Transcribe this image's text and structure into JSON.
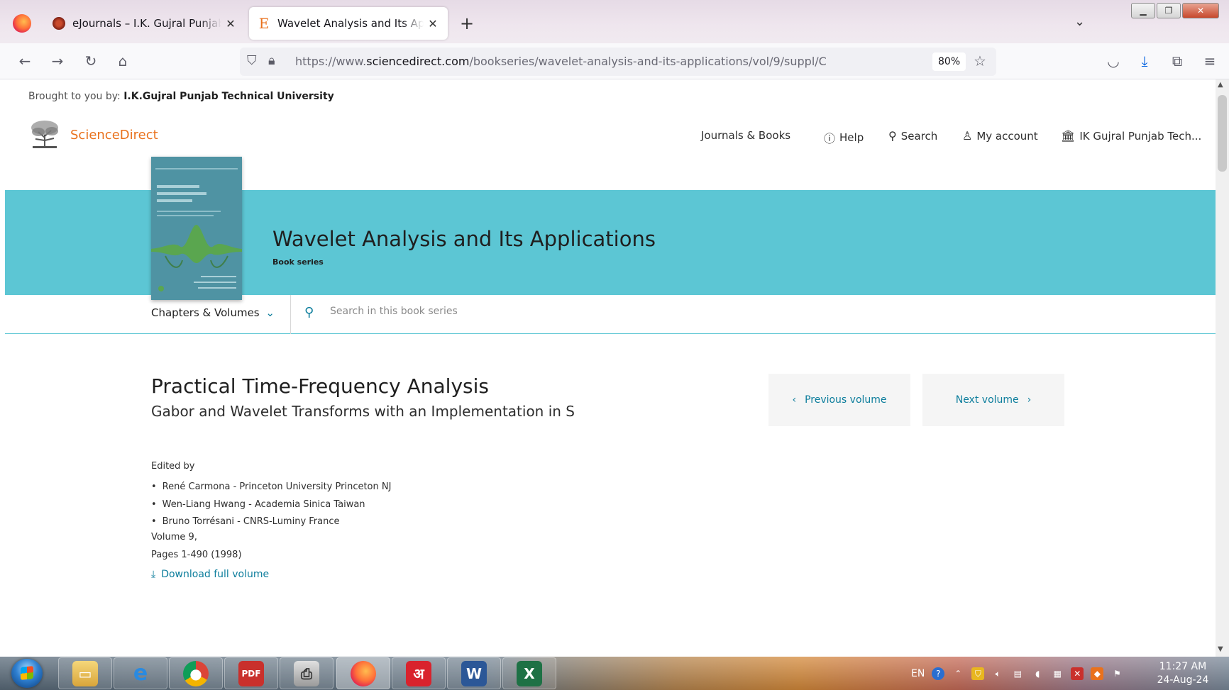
{
  "browser": {
    "tabs": [
      {
        "title": "eJournals – I.K. Gujral Punjab Technical University",
        "active": false
      },
      {
        "title": "Wavelet Analysis and Its Applications | Book series",
        "active": true
      }
    ],
    "url_prefix": "https://www.",
    "url_domain": "sciencedirect.com",
    "url_path": "/bookseries/wavelet-analysis-and-its-applications/vol/9/suppl/C",
    "zoom": "80%"
  },
  "site": {
    "brought_label": "Brought to you by:",
    "brought_org": "I.K.Gujral Punjab Technical University",
    "logo_text": "ScienceDirect",
    "nav": {
      "journals": "Journals & Books",
      "help": "Help",
      "search": "Search",
      "account": "My account",
      "institution": "IK Gujral Punjab Tech..."
    }
  },
  "series": {
    "title": "Wavelet Analysis and Its Applications",
    "subtitle": "Book series",
    "chapters_label": "Chapters & Volumes",
    "search_placeholder": "Search in this book series"
  },
  "volume": {
    "title": "Practical Time-Frequency Analysis",
    "subtitle": "Gabor and Wavelet Transforms with an Implementation in S",
    "prev_label": "Previous volume",
    "next_label": "Next volume",
    "edited_by": "Edited by",
    "editors": [
      "René Carmona - Princeton University Princeton NJ",
      "Wen-Liang Hwang - Academia Sinica Taiwan",
      "Bruno Torrésani - CNRS-Luminy France"
    ],
    "volume_number": "Volume 9,",
    "pages": "Pages 1-490 (1998)",
    "download_label": "Download full volume"
  },
  "taskbar": {
    "language": "EN",
    "time": "11:27 AM",
    "date": "24-Aug-24"
  },
  "colors": {
    "banner": "#5cc6d4",
    "link": "#0c7d9c",
    "brand_orange": "#e9711c"
  }
}
